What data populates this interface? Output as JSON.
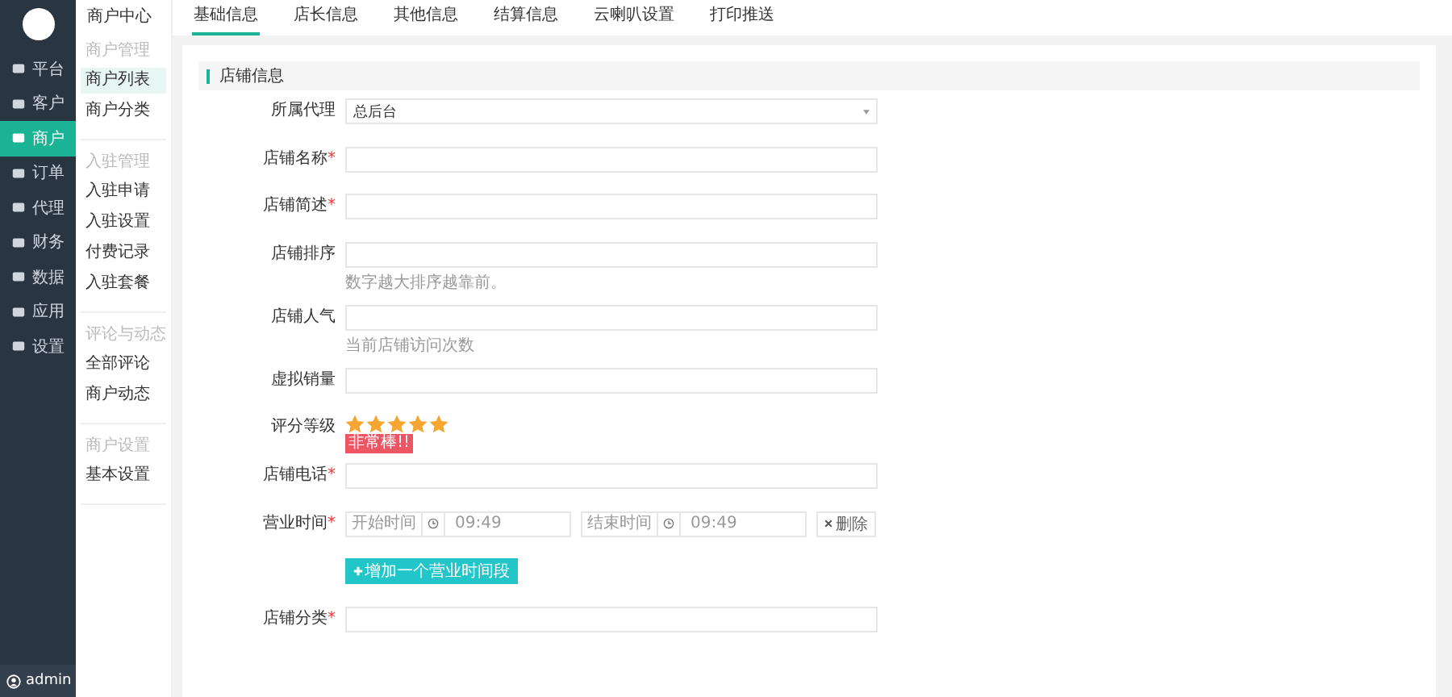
{
  "sidebar": {
    "items": [
      {
        "label": "平台",
        "selected": false
      },
      {
        "label": "客户",
        "selected": false
      },
      {
        "label": "商户",
        "selected": true
      },
      {
        "label": "订单",
        "selected": false
      },
      {
        "label": "代理",
        "selected": false
      },
      {
        "label": "财务",
        "selected": false
      },
      {
        "label": "数据",
        "selected": false
      },
      {
        "label": "应用",
        "selected": false
      },
      {
        "label": "设置",
        "selected": false
      }
    ],
    "user": "admin"
  },
  "subnav": {
    "title": "商户中心",
    "groups": [
      {
        "heading": "商户管理",
        "items": [
          {
            "label": "商户列表",
            "selected": true
          },
          {
            "label": "商户分类",
            "selected": false
          }
        ]
      },
      {
        "heading": "入驻管理",
        "items": [
          {
            "label": "入驻申请",
            "selected": false
          },
          {
            "label": "入驻设置",
            "selected": false
          },
          {
            "label": "付费记录",
            "selected": false
          },
          {
            "label": "入驻套餐",
            "selected": false
          }
        ]
      },
      {
        "heading": "评论与动态",
        "items": [
          {
            "label": "全部评论",
            "selected": false
          },
          {
            "label": "商户动态",
            "selected": false
          }
        ]
      },
      {
        "heading": "商户设置",
        "items": [
          {
            "label": "基本设置",
            "selected": false
          }
        ]
      }
    ]
  },
  "tabs": [
    {
      "label": "基础信息",
      "selected": true
    },
    {
      "label": "店长信息",
      "selected": false
    },
    {
      "label": "其他信息",
      "selected": false
    },
    {
      "label": "结算信息",
      "selected": false
    },
    {
      "label": "云喇叭设置",
      "selected": false
    },
    {
      "label": "打印推送",
      "selected": false
    }
  ],
  "section": "店铺信息",
  "fields": [
    {
      "kind": "select",
      "label": "所属代理",
      "value": "总后台"
    },
    {
      "kind": "text",
      "label": "店铺名称",
      "mark": "*"
    },
    {
      "kind": "text",
      "label": "店铺简述",
      "mark": "*"
    },
    {
      "kind": "text",
      "label": "店铺排序",
      "hint": "数字越大排序越靠前。"
    },
    {
      "kind": "text",
      "label": "店铺人气",
      "hint": "当前店铺访问次数"
    },
    {
      "kind": "text",
      "label": "虚拟销量"
    },
    {
      "kind": "stars",
      "label": "评分等级",
      "stars": 5,
      "badge": "非常棒!!"
    },
    {
      "kind": "text",
      "label": "店铺电话",
      "mark": "*"
    },
    {
      "kind": "hours",
      "label": "营业时间",
      "mark": "*",
      "start_label": "开始时间",
      "start": "09:49",
      "end_label": "结束时间",
      "end": "09:49",
      "remove": "删除",
      "add": "增加一个营业时间段"
    },
    {
      "kind": "text",
      "label": "店铺分类",
      "mark": "*"
    }
  ]
}
